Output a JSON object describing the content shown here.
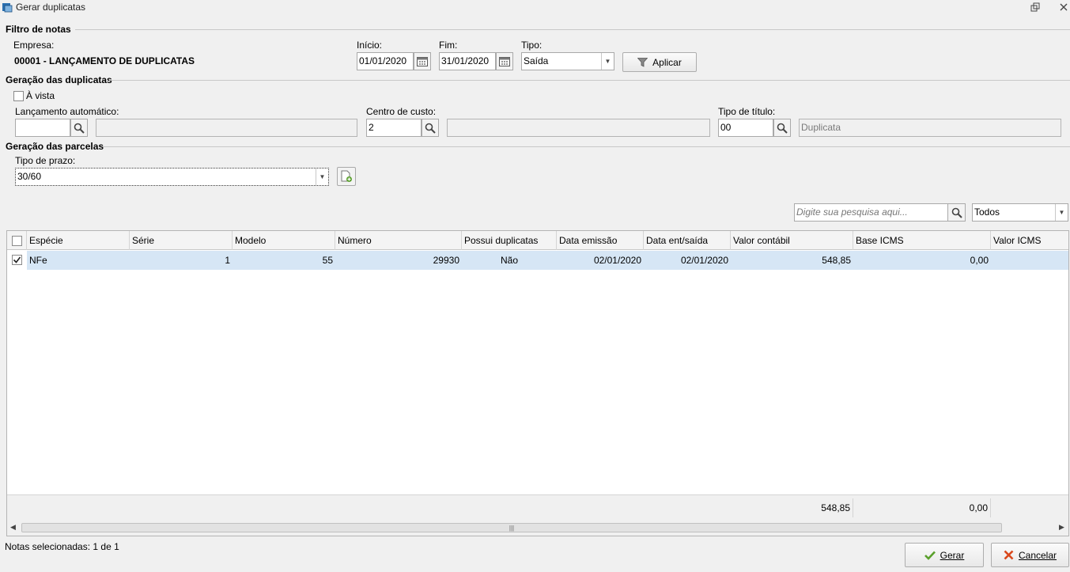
{
  "window": {
    "title": "Gerar duplicatas"
  },
  "filtro": {
    "section_title": "Filtro de notas",
    "empresa_label": "Empresa:",
    "empresa_value": "00001 - LANÇAMENTO DE DUPLICATAS",
    "inicio_label": "Início:",
    "inicio_value": "01/01/2020",
    "fim_label": "Fim:",
    "fim_value": "31/01/2020",
    "tipo_label": "Tipo:",
    "tipo_value": "Saída",
    "aplicar_label": "Aplicar"
  },
  "geracao_duplicatas": {
    "section_title": "Geração das duplicatas",
    "a_vista_label": "À vista",
    "lancamento_label": "Lançamento automático:",
    "lancamento_value": "",
    "lancamento_desc": "",
    "centro_label": "Centro de custo:",
    "centro_value": "2",
    "centro_desc": "",
    "tipo_titulo_label": "Tipo de título:",
    "tipo_titulo_value": "00",
    "tipo_titulo_desc": "Duplicata"
  },
  "geracao_parcelas": {
    "section_title": "Geração das parcelas",
    "tipo_prazo_label": "Tipo de prazo:",
    "tipo_prazo_value": "30/60"
  },
  "search": {
    "placeholder": "Digite sua pesquisa aqui...",
    "filter_value": "Todos"
  },
  "table": {
    "columns": [
      "Espécie",
      "Série",
      "Modelo",
      "Número",
      "Possui duplicatas",
      "Data emissão",
      "Data ent/saída",
      "Valor contábil",
      "Base ICMS",
      "Valor ICMS"
    ],
    "rows": [
      {
        "especie": "NFe",
        "serie": "1",
        "modelo": "55",
        "numero": "29930",
        "possui_duplicatas": "Não",
        "data_emissao": "02/01/2020",
        "data_ent_saida": "02/01/2020",
        "valor_contabil": "548,85",
        "base_icms": "0,00",
        "valor_icms": ""
      }
    ],
    "totals": {
      "valor_contabil": "548,85",
      "base_icms": "0,00"
    }
  },
  "status": {
    "selected_text": "Notas selecionadas: 1 de 1"
  },
  "actions": {
    "gerar_label": "Gerar",
    "cancelar_label": "Cancelar"
  },
  "colors": {
    "selected_row": "#d6e6f5",
    "gerar_icon": "#5aa02c",
    "cancelar_icon": "#d9481c"
  }
}
